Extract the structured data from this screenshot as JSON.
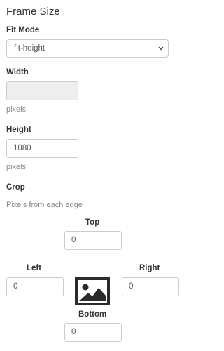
{
  "panel": {
    "title": "Frame Size"
  },
  "fit_mode": {
    "label": "Fit Mode",
    "selected": "fit-height"
  },
  "width": {
    "label": "Width",
    "value": "",
    "unit": "pixels",
    "disabled": true
  },
  "height": {
    "label": "Height",
    "value": "1080",
    "unit": "pixels"
  },
  "crop": {
    "label": "Crop",
    "help": "Pixels from each edge",
    "top": {
      "label": "Top",
      "value": "0"
    },
    "left": {
      "label": "Left",
      "value": "0"
    },
    "right": {
      "label": "Right",
      "value": "0"
    },
    "bottom": {
      "label": "Bottom",
      "value": "0"
    },
    "icon": "image-icon"
  }
}
